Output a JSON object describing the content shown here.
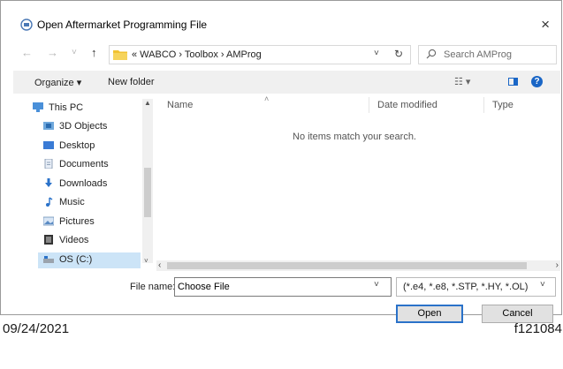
{
  "window": {
    "title": "Open Aftermarket Programming File",
    "close_glyph": "×"
  },
  "nav": {
    "back_glyph": "←",
    "forward_glyph": "→",
    "recent_glyph": "˅",
    "up_glyph": "↑",
    "address": "«  WABCO  ›  Toolbox  ›  AMProg",
    "address_dropdown_glyph": "˅",
    "refresh_glyph": "↻",
    "search_placeholder": "Search AMProg"
  },
  "toolbar": {
    "organize_label": "Organize ▾",
    "new_folder_label": "New folder",
    "view_label": "☷ ▾",
    "help_label": "?"
  },
  "sidebar": {
    "items": [
      {
        "label": "This PC",
        "icon": "pc-icon"
      },
      {
        "label": "3D Objects",
        "icon": "3d-objects-icon"
      },
      {
        "label": "Desktop",
        "icon": "desktop-icon"
      },
      {
        "label": "Documents",
        "icon": "documents-icon"
      },
      {
        "label": "Downloads",
        "icon": "downloads-icon"
      },
      {
        "label": "Music",
        "icon": "music-icon"
      },
      {
        "label": "Pictures",
        "icon": "pictures-icon"
      },
      {
        "label": "Videos",
        "icon": "videos-icon"
      },
      {
        "label": "OS (C:)",
        "icon": "drive-icon"
      }
    ],
    "scroll_up_glyph": "▲",
    "scroll_down_glyph": "˅"
  },
  "file_list": {
    "columns": {
      "name": "Name",
      "date": "Date modified",
      "type": "Type"
    },
    "sort_glyph": "˄",
    "empty_message": "No items match your search.",
    "scroll_left_glyph": "‹",
    "scroll_right_glyph": "›"
  },
  "bottom": {
    "file_name_label": "File name:",
    "file_name_value": "Choose File",
    "file_name_dropdown_glyph": "˅",
    "file_type_value": "(*.e4, *.e8, *.STP, *.HY, *.OL)",
    "file_type_dropdown_glyph": "˅",
    "open_label": "Open",
    "cancel_label": "Cancel"
  },
  "footer": {
    "date": "09/24/2021",
    "figure_id": "f121084"
  },
  "colors": {
    "accent": "#1a66c6",
    "folder": "#f1c232",
    "selected": "#cce4f7"
  }
}
